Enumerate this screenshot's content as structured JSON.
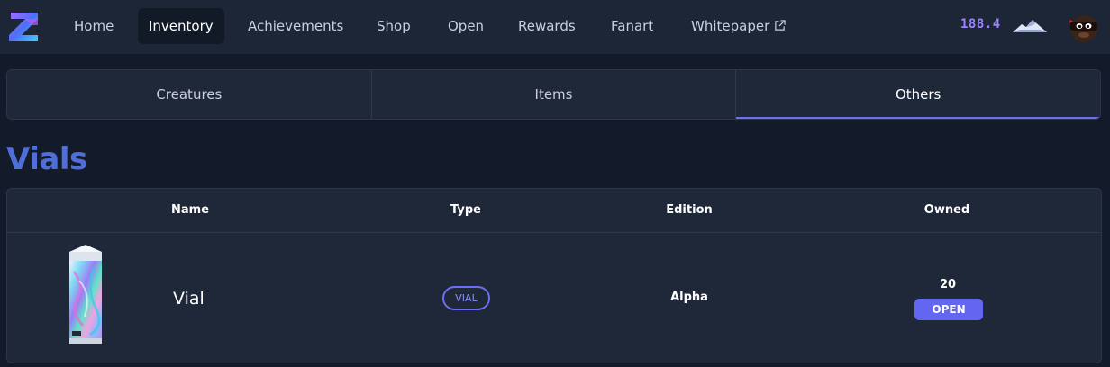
{
  "nav": {
    "items": [
      {
        "label": "Home"
      },
      {
        "label": "Inventory"
      },
      {
        "label": "Achievements"
      },
      {
        "label": "Shop"
      },
      {
        "label": "Open"
      },
      {
        "label": "Rewards"
      },
      {
        "label": "Fanart"
      },
      {
        "label": "Whitepaper"
      }
    ],
    "active": "Inventory",
    "balance": "188.4",
    "icons": {
      "logo": "z-logo-icon",
      "external": "external-link-icon",
      "currency": "mountain-icon",
      "avatar": "ninja-avatar"
    }
  },
  "tabs": {
    "items": [
      {
        "label": "Creatures"
      },
      {
        "label": "Items"
      },
      {
        "label": "Others"
      }
    ],
    "active": "Others"
  },
  "section": {
    "title": "Vials"
  },
  "table": {
    "headers": {
      "name": "Name",
      "type": "Type",
      "edition": "Edition",
      "owned": "Owned"
    },
    "rows": [
      {
        "name": "Vial",
        "type": "VIAL",
        "edition": "Alpha",
        "owned": "20",
        "action": "OPEN"
      }
    ]
  },
  "colors": {
    "accent": "#6366f1",
    "title": "#4f6ed8",
    "balance": "#9d84ff",
    "background": "#131a2a",
    "nav": "#1d2637"
  }
}
